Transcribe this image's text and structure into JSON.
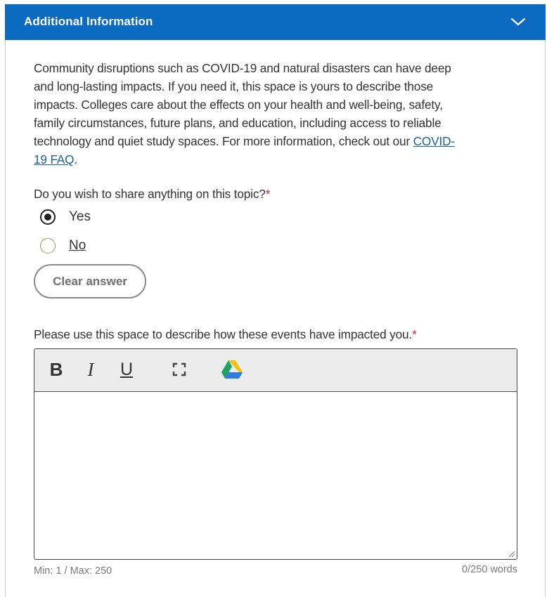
{
  "section": {
    "title": "Additional Information",
    "expanded": true,
    "toggle_icon": "chevron-down-icon",
    "header_color": "#0b6bc1"
  },
  "intro": {
    "text": "Community disruptions such as COVID-19 and natural disasters can have deep and long-lasting impacts. If you need it, this space is yours to describe those impacts. Colleges care about the effects on your health and well-being, safety, family circumstances, future plans, and education, including access to reliable technology and quiet study spaces. For more information, check out our ",
    "link_text": "COVID-19 FAQ",
    "suffix": "."
  },
  "question": {
    "label": "Do you wish to share anything on this topic?",
    "required_marker": "*",
    "options": [
      {
        "label": "Yes",
        "selected": true
      },
      {
        "label": "No",
        "selected": false
      }
    ],
    "clear_label": "Clear answer"
  },
  "essay": {
    "label": "Please use this space to describe how these events have impacted you.",
    "required_marker": "*",
    "toolbar": {
      "bold_label": "B",
      "italic_label": "I",
      "underline_label": "U",
      "fullscreen_icon": "fullscreen-icon",
      "drive_icon": "google-drive-icon"
    },
    "value": "",
    "limits": "Min: 1 / Max: 250",
    "word_count": "0/250 words"
  }
}
